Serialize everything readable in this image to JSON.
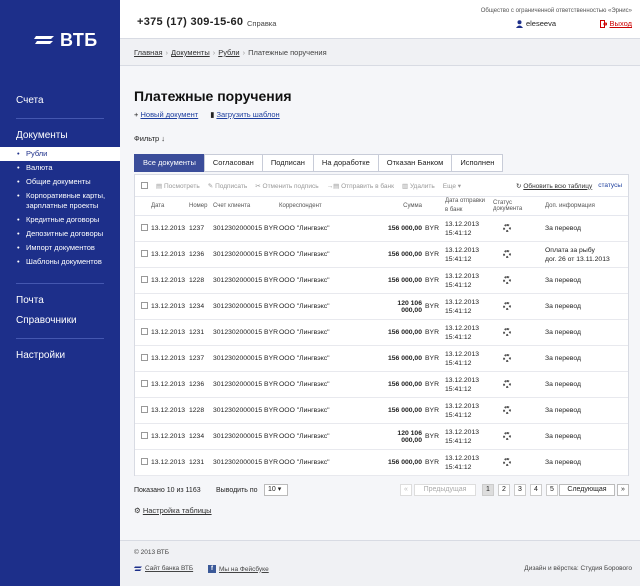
{
  "brand": {
    "name": "ВТБ"
  },
  "topbar": {
    "phone": "+375 (17) 309-15-60",
    "help": "Справка",
    "company": "Общество с ограниченной ответственностью «Эрнис»",
    "user": "eleseeva",
    "logout": "Выход"
  },
  "sidebar": {
    "schet": "Счета",
    "documents": "Документы",
    "doc_items": [
      "Рубли",
      "Валюта",
      "Общие документы",
      "Корпоративные карты, зарплатные проекты",
      "Кредитные договоры",
      "Депозитные договоры",
      "Импорт документов",
      "Шаблоны документов"
    ],
    "pochta": "Почта",
    "spravochniki": "Справочники",
    "nastroiki": "Настройки"
  },
  "breadcrumb": {
    "home": "Главная",
    "docs": "Документы",
    "rub": "Рубли",
    "current": "Платежные поручения"
  },
  "page": {
    "title": "Платежные поручения",
    "new_doc": "Новый документ",
    "load_template": "Загрузить шаблон",
    "filter": "Фильтр"
  },
  "tabs": [
    "Все документы",
    "Согласован",
    "Подписан",
    "На доработке",
    "Отказан Банком",
    "Исполнен"
  ],
  "toolbar": {
    "view": "Посмотреть",
    "sign": "Подписать",
    "unsign": "Отменить подпись",
    "send": "Отправить в банк",
    "delete": "Удалить",
    "more": "Еще",
    "refresh": "Обновить всю таблицу",
    "statuses": "статусы"
  },
  "columns": {
    "date": "Дата",
    "number": "Номер",
    "account": "Счет клиента",
    "correspondent": "Корреспондент",
    "sum": "Сумма",
    "sent_line1": "Дата отправки",
    "sent_line2": "в банк",
    "status_line1": "Статус",
    "status_line2": "документа",
    "info": "Доп. информация"
  },
  "rows": [
    {
      "date": "13.12.2013",
      "num": "1237",
      "acc": "3012302000015 BYR",
      "corr": "ООО \"Лингвэкс\"",
      "sum": "156 000,00",
      "cur": "BYR",
      "sent_d": "13.12.2013",
      "sent_t": "15:41:12",
      "info1": "За перевод",
      "info2": ""
    },
    {
      "date": "13.12.2013",
      "num": "1236",
      "acc": "3012302000015 BYR",
      "corr": "ООО \"Лингвэкс\"",
      "sum": "156 000,00",
      "cur": "BYR",
      "sent_d": "13.12.2013",
      "sent_t": "15:41:12",
      "info1": "Оплата за рыбу",
      "info2": "дог. 26 от 13.11.2013"
    },
    {
      "date": "13.12.2013",
      "num": "1228",
      "acc": "3012302000015 BYR",
      "corr": "ООО \"Лингвэкс\"",
      "sum": "156 000,00",
      "cur": "BYR",
      "sent_d": "13.12.2013",
      "sent_t": "15:41:12",
      "info1": "За перевод",
      "info2": ""
    },
    {
      "date": "13.12.2013",
      "num": "1234",
      "acc": "3012302000015 BYR",
      "corr": "ООО \"Лингвэкс\"",
      "sum": "120 106 000,00",
      "cur": "BYR",
      "sent_d": "13.12.2013",
      "sent_t": "15:41:12",
      "info1": "За перевод",
      "info2": ""
    },
    {
      "date": "13.12.2013",
      "num": "1231",
      "acc": "3012302000015 BYR",
      "corr": "ООО \"Лингвэкс\"",
      "sum": "156 000,00",
      "cur": "BYR",
      "sent_d": "13.12.2013",
      "sent_t": "15:41:12",
      "info1": "За перевод",
      "info2": ""
    },
    {
      "date": "13.12.2013",
      "num": "1237",
      "acc": "3012302000015 BYR",
      "corr": "ООО \"Лингвэкс\"",
      "sum": "156 000,00",
      "cur": "BYR",
      "sent_d": "13.12.2013",
      "sent_t": "15:41:12",
      "info1": "За перевод",
      "info2": ""
    },
    {
      "date": "13.12.2013",
      "num": "1236",
      "acc": "3012302000015 BYR",
      "corr": "ООО \"Лингвэкс\"",
      "sum": "156 000,00",
      "cur": "BYR",
      "sent_d": "13.12.2013",
      "sent_t": "15:41:12",
      "info1": "За перевод",
      "info2": ""
    },
    {
      "date": "13.12.2013",
      "num": "1228",
      "acc": "3012302000015 BYR",
      "corr": "ООО \"Лингвэкс\"",
      "sum": "156 000,00",
      "cur": "BYR",
      "sent_d": "13.12.2013",
      "sent_t": "15:41:12",
      "info1": "За перевод",
      "info2": ""
    },
    {
      "date": "13.12.2013",
      "num": "1234",
      "acc": "3012302000015 BYR",
      "corr": "ООО \"Лингвэкс\"",
      "sum": "120 106 000,00",
      "cur": "BYR",
      "sent_d": "13.12.2013",
      "sent_t": "15:41:12",
      "info1": "За перевод",
      "info2": ""
    },
    {
      "date": "13.12.2013",
      "num": "1231",
      "acc": "3012302000015 BYR",
      "corr": "ООО \"Лингвэкс\"",
      "sum": "156 000,00",
      "cur": "BYR",
      "sent_d": "13.12.2013",
      "sent_t": "15:41:12",
      "info1": "За перевод",
      "info2": ""
    }
  ],
  "pager": {
    "shown": "Показано 10 из 1163",
    "per_page_label": "Выводить по",
    "per_page_value": "10",
    "prev": "Предыдущая",
    "pages": [
      "1",
      "2",
      "3",
      "4",
      "5"
    ],
    "next": "Следующая"
  },
  "table_settings": "Настройка таблицы",
  "footer": {
    "copyright": "© 2013 ВТБ",
    "site_link": "Сайт банка ВТБ",
    "fb_link": "Мы на Фейсбуке",
    "credits": "Дизайн и вёрстка: Студия Борового"
  },
  "colors": {
    "sidebar": "#1d2f8a",
    "active_tab": "#3b4d9a",
    "link": "#1d3e9e",
    "logout": "#cc0000"
  }
}
